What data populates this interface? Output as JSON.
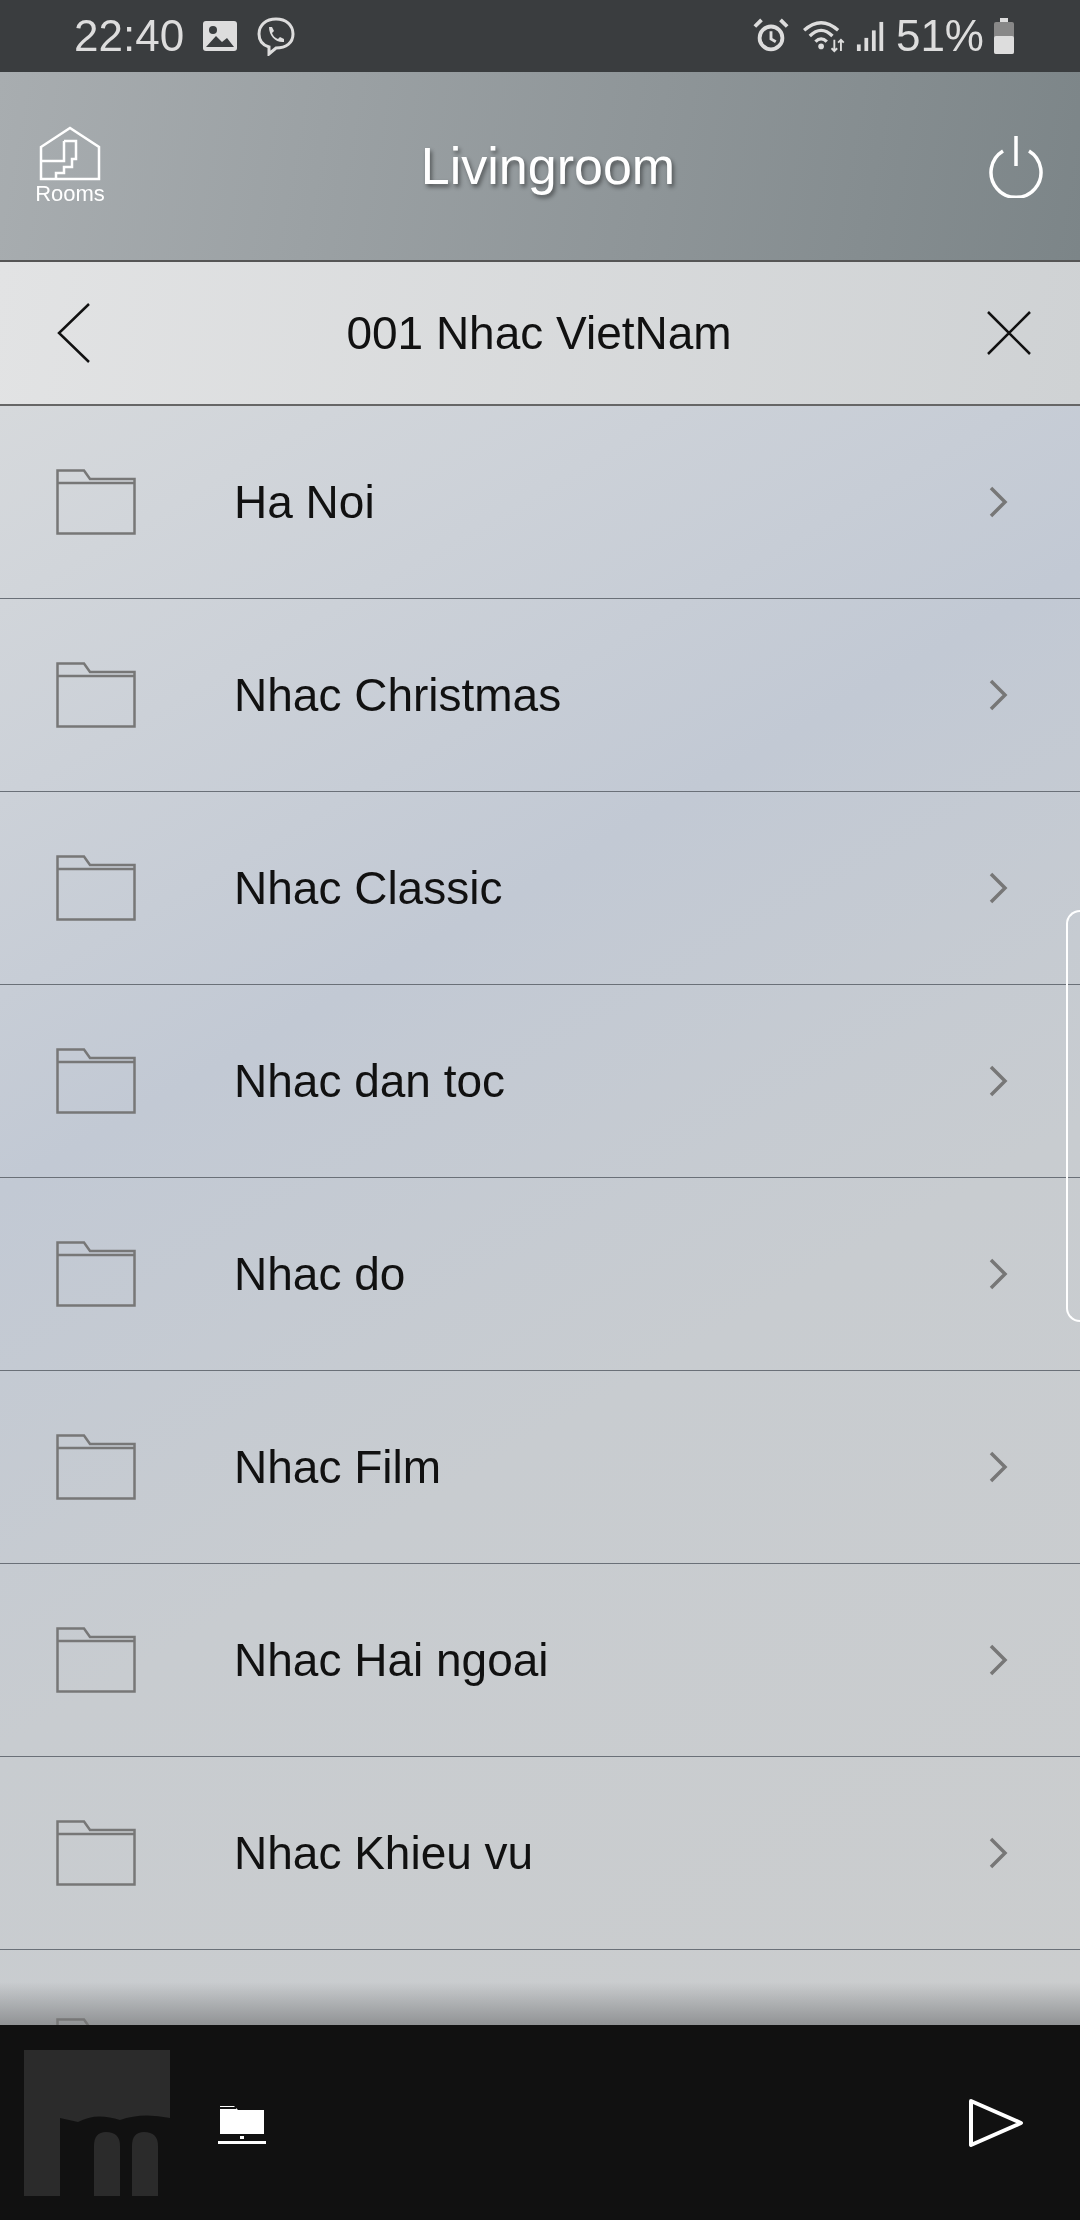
{
  "status_bar": {
    "time": "22:40",
    "battery": "51%"
  },
  "header": {
    "rooms_label": "Rooms",
    "title": "Livingroom"
  },
  "subheader": {
    "title": "001 Nhac VietNam"
  },
  "folders": [
    {
      "name": "Ha Noi"
    },
    {
      "name": "Nhac Christmas"
    },
    {
      "name": "Nhac Classic"
    },
    {
      "name": "Nhac dan toc"
    },
    {
      "name": "Nhac do"
    },
    {
      "name": "Nhac Film"
    },
    {
      "name": "Nhac Hai ngoai"
    },
    {
      "name": "Nhac Khieu vu"
    }
  ]
}
